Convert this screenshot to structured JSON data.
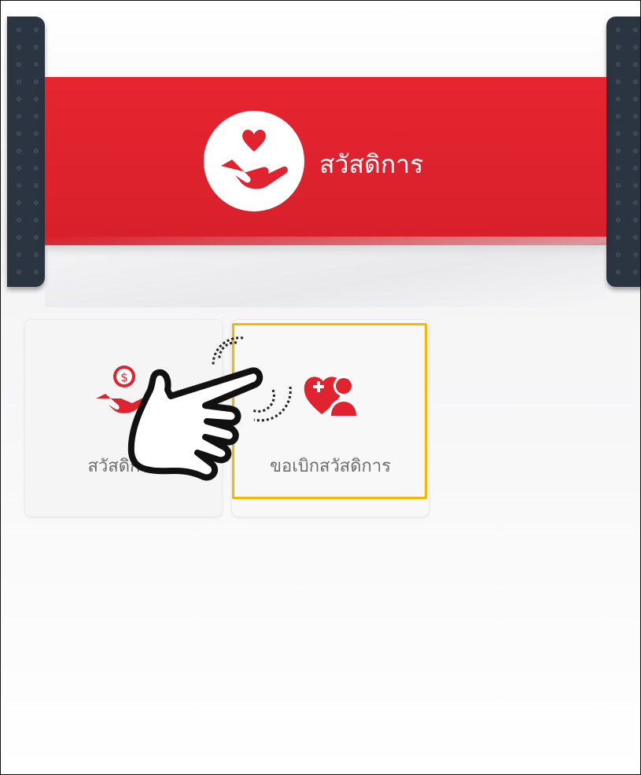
{
  "header": {
    "title": "สวัสดิการ",
    "logo_icon": "hand-heart-icon"
  },
  "menu": {
    "items": [
      {
        "label": "สวัสดิการ",
        "icon": "hand-coin-icon"
      },
      {
        "label": "ขอเบิกสวัสดิการ",
        "icon": "heart-person-plus-icon",
        "highlighted": true
      }
    ]
  },
  "overlay": {
    "icon": "tap-hand-pointer-icon"
  },
  "colors": {
    "brand_red": "#e0232e",
    "highlight": "#f5b800",
    "panel_dark": "#2b3441"
  }
}
